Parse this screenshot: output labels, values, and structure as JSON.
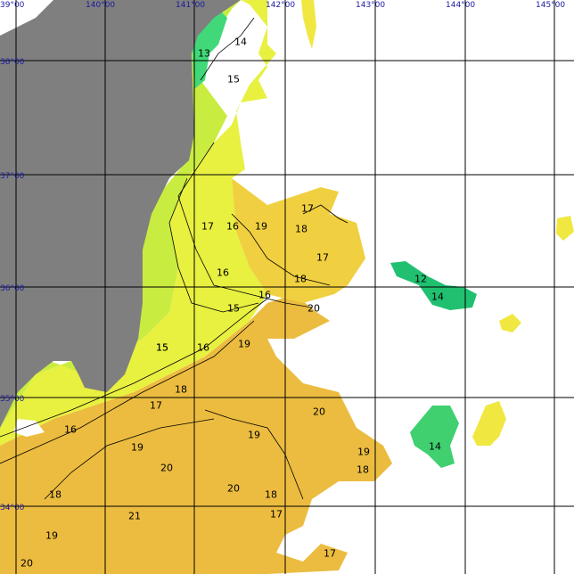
{
  "map": {
    "longitude_labels": [
      "39°00",
      "140°00",
      "141°00",
      "142°00",
      "143°00",
      "144°00",
      "145°00"
    ],
    "latitude_labels": [
      "38°00",
      "37°00",
      "36°00",
      "35°00",
      "34°00"
    ],
    "land_color": "#7f7f7f",
    "sea_no_data_color": "#ffffff",
    "temperature_palette": {
      "12": "#20c070",
      "13": "#30d890",
      "14": "#40d070",
      "15": "#a8e048",
      "16": "#c8ec40",
      "17": "#e8f040",
      "18": "#f0e840",
      "19": "#f0d040",
      "20": "#ecbc40",
      "21": "#e4a840"
    },
    "isotherm_labels": [
      "14",
      "13",
      "15",
      "15",
      "17",
      "16",
      "19",
      "18",
      "17",
      "17",
      "16",
      "18",
      "16",
      "15",
      "20",
      "12",
      "14",
      "15",
      "16",
      "19",
      "18",
      "17",
      "16",
      "20",
      "19",
      "19",
      "19",
      "20",
      "20",
      "18",
      "18",
      "21",
      "17",
      "19",
      "14",
      "18",
      "20",
      "17"
    ]
  }
}
